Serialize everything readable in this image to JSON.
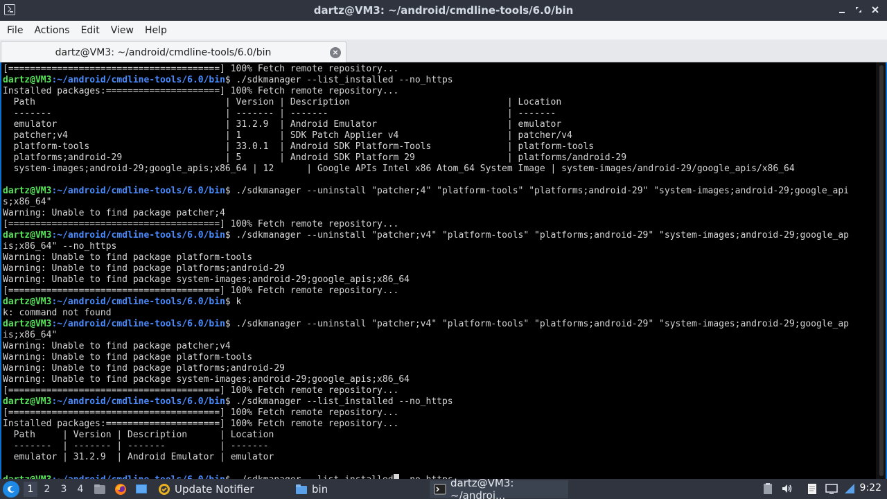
{
  "window": {
    "title": "dartz@VM3: ~/android/cmdline-tools/6.0/bin",
    "buttons": [
      "minimize",
      "maximize",
      "close"
    ]
  },
  "menubar": {
    "items": [
      "File",
      "Actions",
      "Edit",
      "View",
      "Help"
    ]
  },
  "tab": {
    "label": "dartz@VM3: ~/android/cmdline-tools/6.0/bin"
  },
  "terminal": {
    "prompt_user": "dartz@VM3",
    "prompt_path": ":~/android/cmdline-tools/6.0/bin",
    "lines": [
      {
        "type": "text",
        "text": "[=======================================] 100% Fetch remote repository..."
      },
      {
        "type": "prompt",
        "cmd": "$ ./sdkmanager --list_installed --no_https"
      },
      {
        "type": "text",
        "text": "Installed packages:=====================] 100% Fetch remote repository..."
      },
      {
        "type": "text",
        "text": "  Path                                   | Version | Description                             | Location"
      },
      {
        "type": "text",
        "text": "  -------                                | ------- | -------                                 | -------"
      },
      {
        "type": "text",
        "text": "  emulator                               | 31.2.9  | Android Emulator                        | emulator"
      },
      {
        "type": "text",
        "text": "  patcher;v4                             | 1       | SDK Patch Applier v4                    | patcher/v4"
      },
      {
        "type": "text",
        "text": "  platform-tools                         | 33.0.1  | Android SDK Platform-Tools              | platform-tools"
      },
      {
        "type": "text",
        "text": "  platforms;android-29                   | 5       | Android SDK Platform 29                 | platforms/android-29"
      },
      {
        "type": "text",
        "text": "  system-images;android-29;google_apis;x86_64 | 12      | Google APIs Intel x86 Atom_64 System Image | system-images/android-29/google_apis/x86_64"
      },
      {
        "type": "text",
        "text": ""
      },
      {
        "type": "prompt",
        "cmd": "$ ./sdkmanager --uninstall \"patcher;4\" \"platform-tools\" \"platforms;android-29\" \"system-images;android-29;google_api"
      },
      {
        "type": "text",
        "text": "s;x86_64\""
      },
      {
        "type": "text",
        "text": "Warning: Unable to find package patcher;4"
      },
      {
        "type": "text",
        "text": "[=======================================] 100% Fetch remote repository..."
      },
      {
        "type": "prompt",
        "cmd": "$ ./sdkmanager --uninstall \"patcher;v4\" \"platform-tools\" \"platforms;android-29\" \"system-images;android-29;google_ap"
      },
      {
        "type": "text",
        "text": "is;x86_64\" --no_https"
      },
      {
        "type": "text",
        "text": "Warning: Unable to find package platform-tools"
      },
      {
        "type": "text",
        "text": "Warning: Unable to find package platforms;android-29"
      },
      {
        "type": "text",
        "text": "Warning: Unable to find package system-images;android-29;google_apis;x86_64"
      },
      {
        "type": "text",
        "text": "[=======================================] 100% Fetch remote repository..."
      },
      {
        "type": "prompt",
        "cmd": "$ k"
      },
      {
        "type": "text",
        "text": "k: command not found"
      },
      {
        "type": "prompt",
        "cmd": "$ ./sdkmanager --uninstall \"patcher;v4\" \"platform-tools\" \"platforms;android-29\" \"system-images;android-29;google_ap"
      },
      {
        "type": "text",
        "text": "is;x86_64\""
      },
      {
        "type": "text",
        "text": "Warning: Unable to find package patcher;v4"
      },
      {
        "type": "text",
        "text": "Warning: Unable to find package platform-tools"
      },
      {
        "type": "text",
        "text": "Warning: Unable to find package platforms;android-29"
      },
      {
        "type": "text",
        "text": "Warning: Unable to find package system-images;android-29;google_apis;x86_64"
      },
      {
        "type": "text",
        "text": "[=======================================] 100% Fetch remote repository..."
      },
      {
        "type": "prompt",
        "cmd": "$ ./sdkmanager --list_installed --no_https"
      },
      {
        "type": "text",
        "text": "[=======================================] 100% Fetch remote repository..."
      },
      {
        "type": "text",
        "text": "Installed packages:=====================] 100% Fetch remote repository..."
      },
      {
        "type": "text",
        "text": "  Path     | Version | Description      | Location"
      },
      {
        "type": "text",
        "text": "  -------  | ------- | -------          | -------"
      },
      {
        "type": "text",
        "text": "  emulator | 31.2.9  | Android Emulator | emulator"
      },
      {
        "type": "text",
        "text": ""
      },
      {
        "type": "prompt_cursor",
        "cmd_before": "$ ./sdkmanager --list_installed",
        "cmd_after": "--no_https"
      }
    ]
  },
  "taskbar": {
    "workspaces": [
      "1",
      "2",
      "3",
      "4"
    ],
    "active_workspace": "1",
    "tasks": [
      {
        "label": "Update Notifier",
        "icon": "update-notifier-icon"
      },
      {
        "label": "bin",
        "icon": "folder-icon"
      },
      {
        "label": "dartz@VM3: ~/androi...",
        "icon": "terminal-icon"
      }
    ],
    "clock": "9:22"
  }
}
